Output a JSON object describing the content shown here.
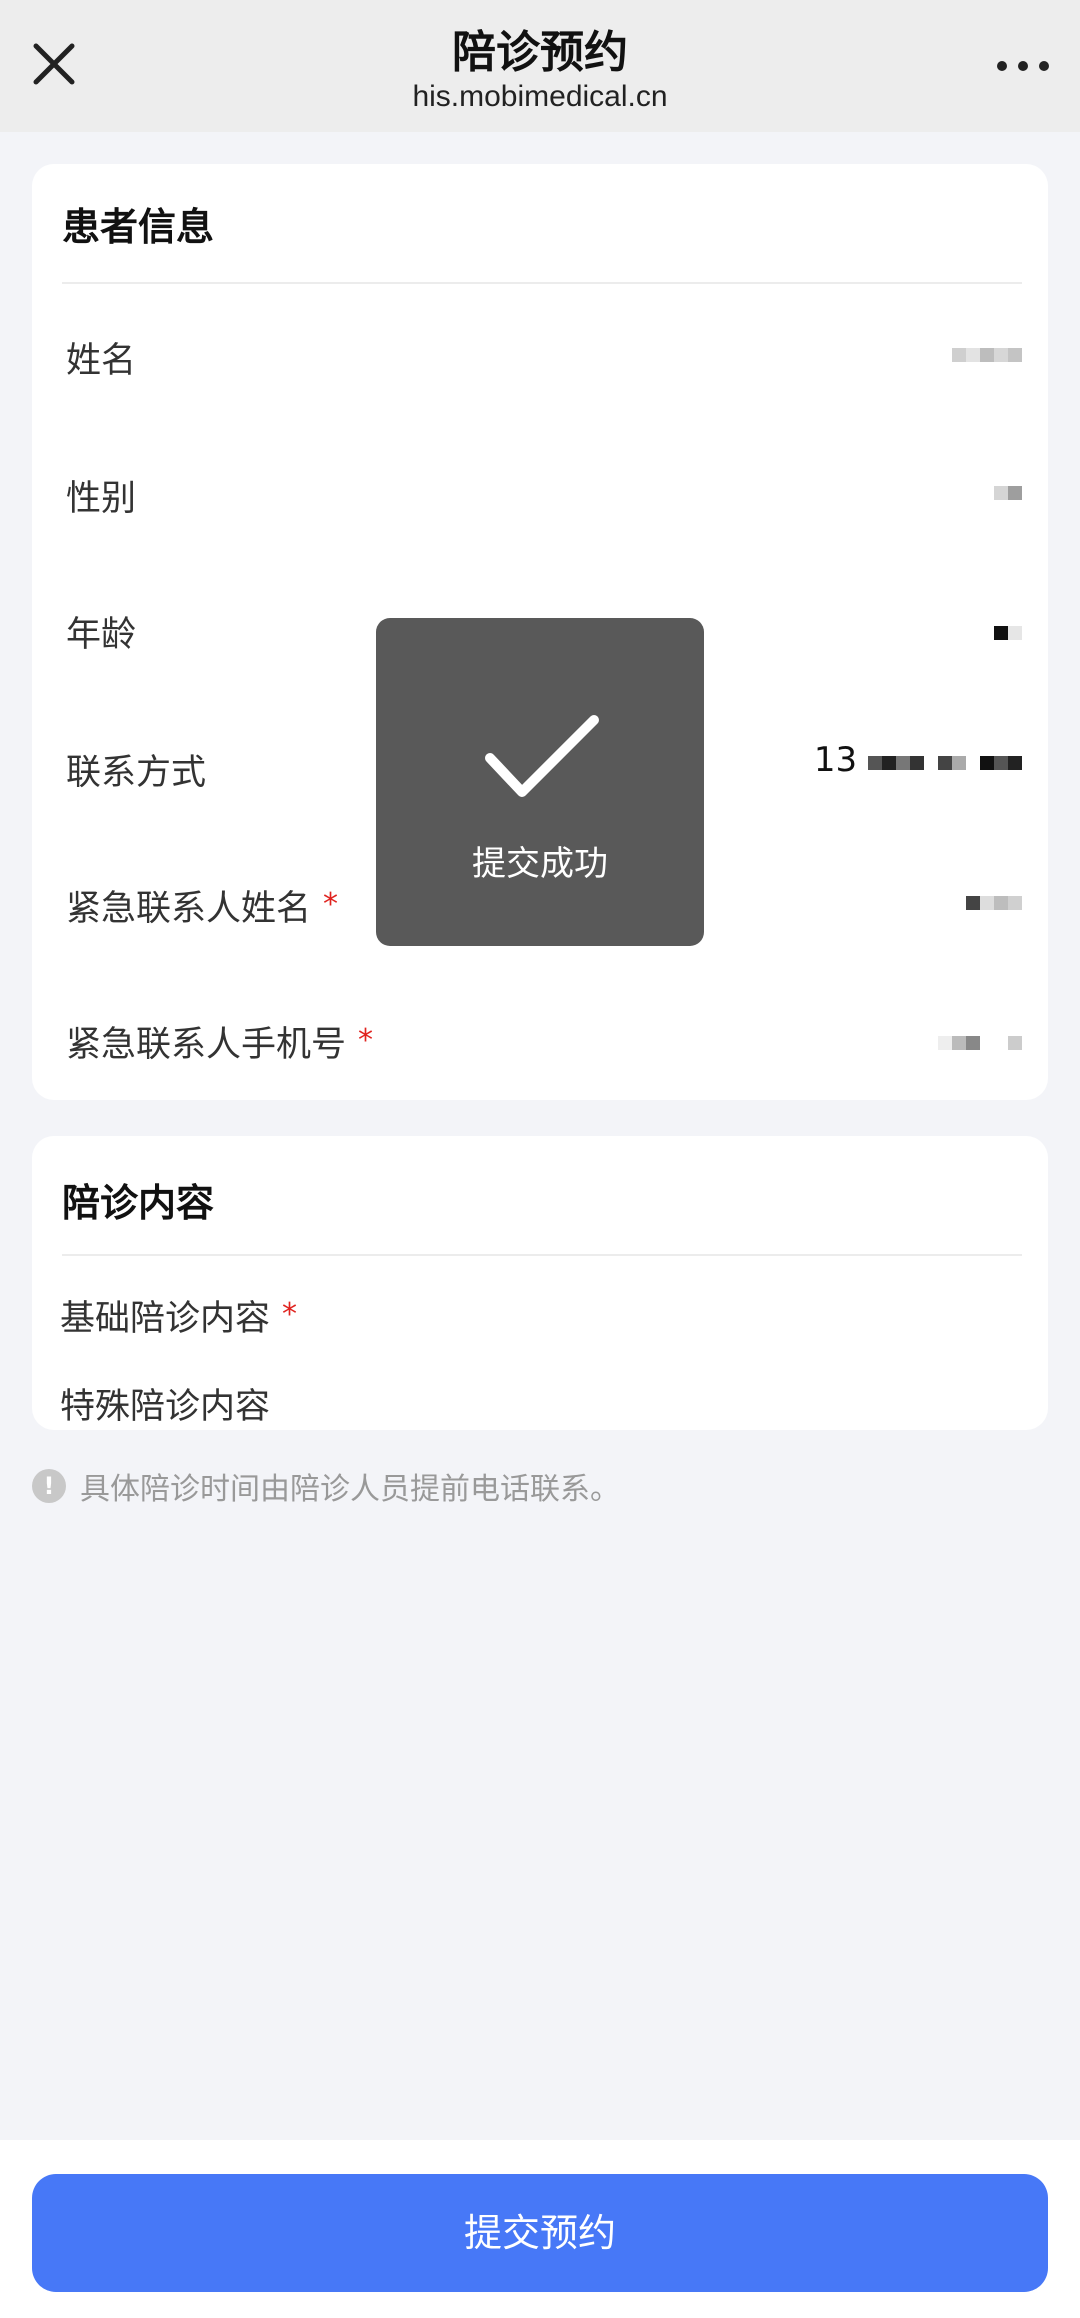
{
  "header": {
    "title": "陪诊预约",
    "domain": "his.mobimedical.cn",
    "close_icon": "close-icon",
    "more_icon": "more-icon"
  },
  "patient_card": {
    "title": "患者信息",
    "rows": [
      {
        "label": "姓名",
        "value": "",
        "required": false
      },
      {
        "label": "性别",
        "value": "",
        "required": false
      },
      {
        "label": "年龄",
        "value": "",
        "required": false
      },
      {
        "label": "联系方式",
        "value": "13",
        "required": false
      },
      {
        "label": "紧急联系人姓名",
        "value": "",
        "required": true,
        "req_mark": "*"
      },
      {
        "label": "紧急联系人手机号",
        "value": "",
        "required": true,
        "req_mark": "*"
      }
    ]
  },
  "service_card": {
    "title": "陪诊内容",
    "basic_label": "基础陪诊内容",
    "basic_req": "*",
    "special_label": "特殊陪诊内容"
  },
  "tip": {
    "icon": "info-icon",
    "icon_glyph": "!",
    "text": "具体陪诊时间由陪诊人员提前电话联系。"
  },
  "toast": {
    "icon": "check-icon",
    "text": "提交成功"
  },
  "footer": {
    "submit_label": "提交预约"
  },
  "colors": {
    "accent": "#4778f7",
    "required": "#e0231f",
    "background": "#f3f4f8",
    "topbar": "#ededed"
  }
}
